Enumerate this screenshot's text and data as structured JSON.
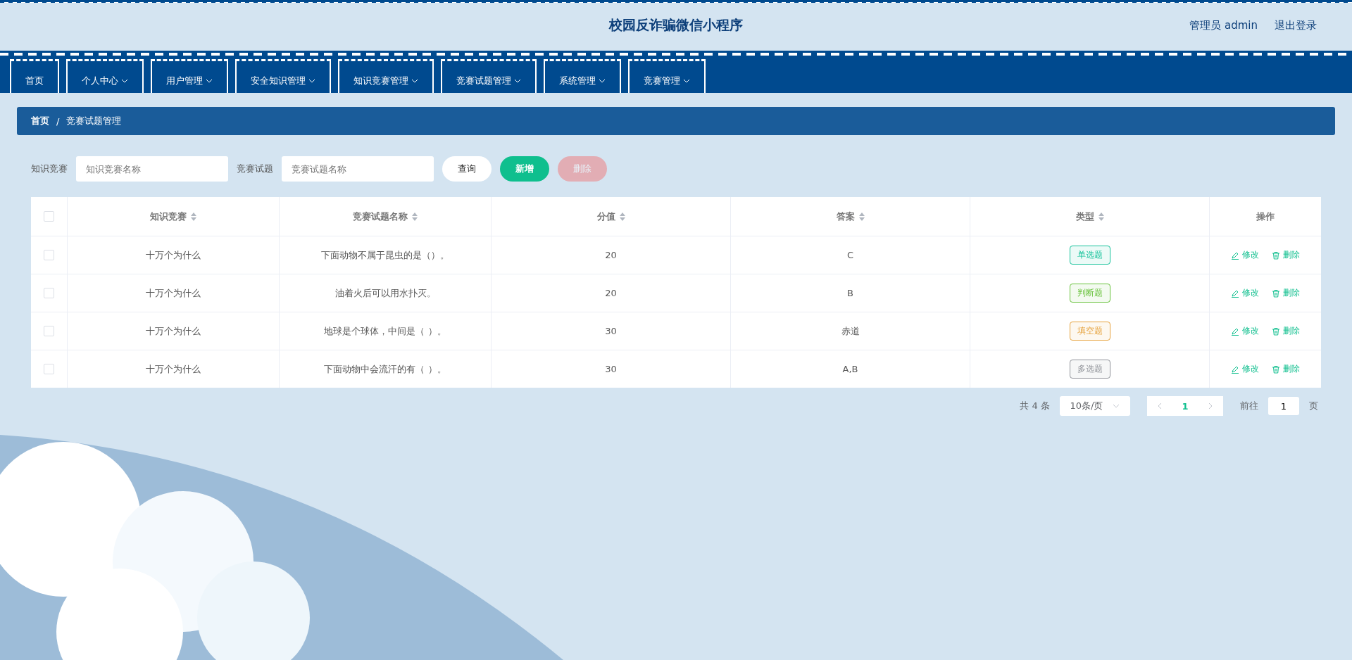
{
  "header": {
    "title": "校园反诈骗微信小程序",
    "user": "管理员 admin",
    "logout": "退出登录"
  },
  "nav": [
    {
      "label": "首页",
      "dropdown": false,
      "selected": false
    },
    {
      "label": "个人中心",
      "dropdown": true,
      "selected": false
    },
    {
      "label": "用户管理",
      "dropdown": true,
      "selected": false
    },
    {
      "label": "安全知识管理",
      "dropdown": true,
      "selected": false
    },
    {
      "label": "知识竞赛管理",
      "dropdown": true,
      "selected": false
    },
    {
      "label": "竞赛试题管理",
      "dropdown": true,
      "selected": false
    },
    {
      "label": "系统管理",
      "dropdown": true,
      "selected": false
    },
    {
      "label": "竞赛管理",
      "dropdown": true,
      "selected": false
    }
  ],
  "breadcrumb": {
    "items": [
      "首页",
      "竞赛试题管理"
    ],
    "separator": "/"
  },
  "search": {
    "fields": [
      {
        "label": "知识竞赛",
        "placeholder": "知识竞赛名称"
      },
      {
        "label": "竞赛试题",
        "placeholder": "竞赛试题名称"
      }
    ],
    "buttons": [
      {
        "label": "查询",
        "kind": "plain",
        "disabled": false
      },
      {
        "label": "新增",
        "kind": "primary",
        "disabled": false
      },
      {
        "label": "删除",
        "kind": "danger",
        "disabled": true
      }
    ]
  },
  "table": {
    "select_all_checked": false,
    "columns": [
      {
        "label": "知识竞赛",
        "sortable": true
      },
      {
        "label": "竞赛试题名称",
        "sortable": true
      },
      {
        "label": "分值",
        "sortable": true
      },
      {
        "label": "答案",
        "sortable": true
      },
      {
        "label": "类型",
        "sortable": true
      },
      {
        "label": "操作",
        "sortable": false
      }
    ],
    "rows": [
      {
        "checked": false,
        "contest": "十万个为什么",
        "question": "下面动物不属于昆虫的是（）。",
        "score": "20",
        "answer": "C",
        "type": "单选题",
        "color": "#13c29a",
        "actions": [
          "修改",
          "删除"
        ]
      },
      {
        "checked": false,
        "contest": "十万个为什么",
        "question": "油着火后可以用水扑灭。",
        "score": "20",
        "answer": "B",
        "type": "判断题",
        "color": "#67c23a",
        "actions": [
          "修改",
          "删除"
        ]
      },
      {
        "checked": false,
        "contest": "十万个为什么",
        "question": "地球是个球体，中间是（ ）。",
        "score": "30",
        "answer": "赤道",
        "type": "填空题",
        "color": "#e6a23c",
        "actions": [
          "修改",
          "删除"
        ]
      },
      {
        "checked": false,
        "contest": "十万个为什么",
        "question": "下面动物中会流汗的有（ ）。",
        "score": "30",
        "answer": "A,B",
        "type": "多选题",
        "color": "#909399",
        "actions": [
          "修改",
          "删除"
        ]
      }
    ]
  },
  "pagination": {
    "total": "共 4 条",
    "page_size": "10条/页",
    "pages": [
      {
        "label": "1",
        "selected": true
      }
    ],
    "goto_label": "前往",
    "goto_value": "1",
    "goto_suffix": "页"
  }
}
